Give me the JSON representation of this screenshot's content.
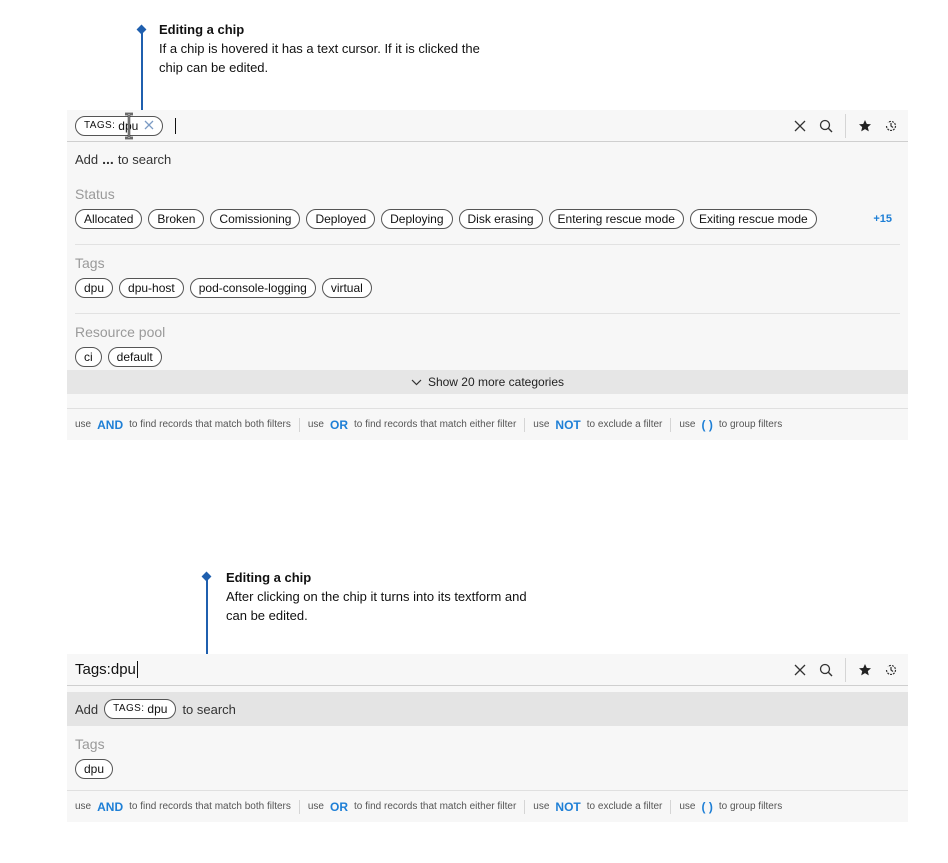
{
  "top": {
    "annotation": {
      "title": "Editing a chip",
      "line1": "If a chip is hovered it has a text cursor. If it is clicked the",
      "line2": "chip can be edited."
    },
    "search_chip": {
      "lead": "TAGS:",
      "value": "dpu"
    },
    "add_row": {
      "prefix": "Add",
      "placeholder": "...",
      "suffix": "to search"
    },
    "categories": [
      {
        "title": "Status",
        "chips": [
          "Allocated",
          "Broken",
          "Comissioning",
          "Deployed",
          "Deploying",
          "Disk erasing",
          "Entering rescue mode",
          "Exiting rescue mode"
        ],
        "more": "+15"
      },
      {
        "title": "Tags",
        "chips": [
          "dpu",
          "dpu-host",
          "pod-console-logging",
          "virtual"
        ]
      },
      {
        "title": "Resource pool",
        "chips": [
          "ci",
          "default"
        ]
      }
    ],
    "show_more": "Show 20 more categories"
  },
  "bottom": {
    "annotation": {
      "title": "Editing a chip",
      "line1": "After clicking on the chip it turns into its textform and",
      "line2": "can be edited."
    },
    "search_value": "Tags:dpu",
    "add_row": {
      "prefix": "Add",
      "chip_lead": "TAGS:",
      "chip_value": "dpu",
      "suffix": "to search"
    },
    "category": {
      "title": "Tags",
      "chips": [
        "dpu"
      ]
    }
  },
  "help": [
    {
      "pre": "use",
      "kw": "AND",
      "post": "to find records that match both filters"
    },
    {
      "pre": "use",
      "kw": "OR",
      "post": "to find records that match either filter"
    },
    {
      "pre": "use",
      "kw": "NOT",
      "post": "to exclude a filter"
    },
    {
      "pre": "use",
      "kw": "( )",
      "post": "to group filters"
    }
  ],
  "icons": [
    "close-icon",
    "search-icon",
    "star-icon",
    "history-icon",
    "chevron-down-icon",
    "text-cursor-icon"
  ],
  "colors": {
    "accent": "#1e7fd6",
    "annotation": "#1f5fae",
    "panel": "#f7f7f7"
  }
}
